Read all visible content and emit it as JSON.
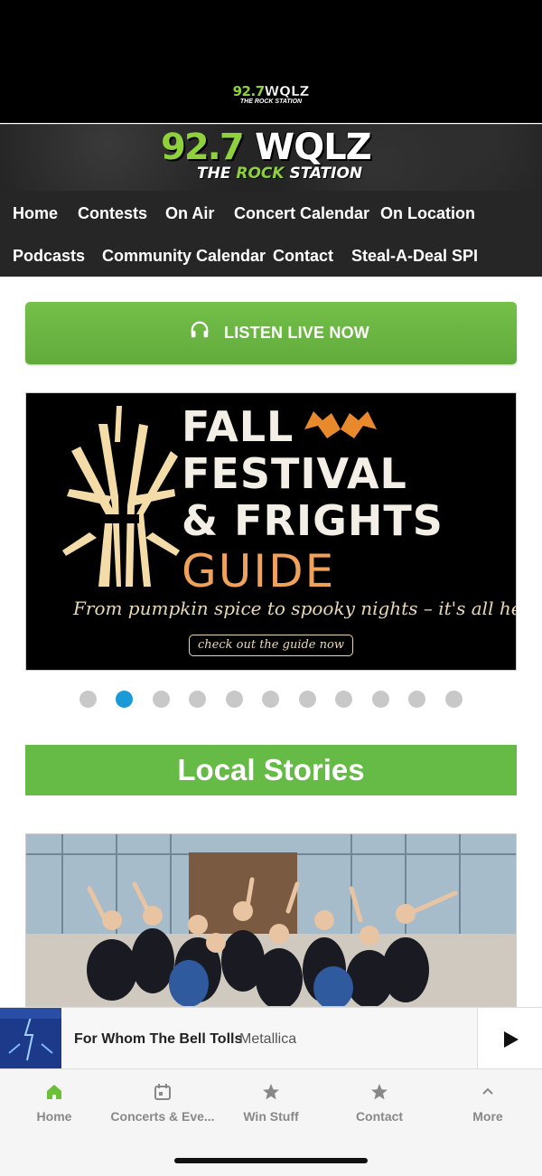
{
  "header": {
    "small_logo": {
      "num": "92.7",
      "call": "WQLZ",
      "tag": "THE ROCK STATION"
    },
    "big_logo": {
      "num": "92.7",
      "call": "WQLZ",
      "tag_pre": "THE ",
      "tag_rock": "ROCK",
      "tag_post": " STATION"
    }
  },
  "nav": {
    "items": [
      "Home",
      "Contests",
      "On Air",
      "Concert Calendar",
      "On Location",
      "Podcasts",
      "Community Calendar",
      "Contact",
      "Steal-A-Deal SPI"
    ]
  },
  "listen": {
    "label": "LISTEN LIVE NOW",
    "icon": "headphones-icon"
  },
  "slide": {
    "line1": "FALL",
    "line2": "FESTIVAL",
    "line3": "& FRIGHTS",
    "line4": "GUIDE",
    "subtitle": "From pumpkin spice to spooky nights – it's all here.",
    "cta": "check out the guide now"
  },
  "carousel": {
    "count": 11,
    "active_index": 1
  },
  "section": {
    "title": "Local Stories"
  },
  "player": {
    "song": "For Whom The Bell Tolls",
    "artist": "Metallica"
  },
  "tabs": [
    {
      "label": "Home",
      "icon": "home-icon"
    },
    {
      "label": "Concerts & Eve...",
      "icon": "calendar-icon"
    },
    {
      "label": "Win Stuff",
      "icon": "star-icon"
    },
    {
      "label": "Contact",
      "icon": "star-icon"
    },
    {
      "label": "More",
      "icon": "chevron-up-icon"
    }
  ],
  "colors": {
    "accent_green": "#65bb45",
    "active_dot": "#1a9ad6",
    "nav_bg": "#262626",
    "home_tab": "#6cc037"
  }
}
